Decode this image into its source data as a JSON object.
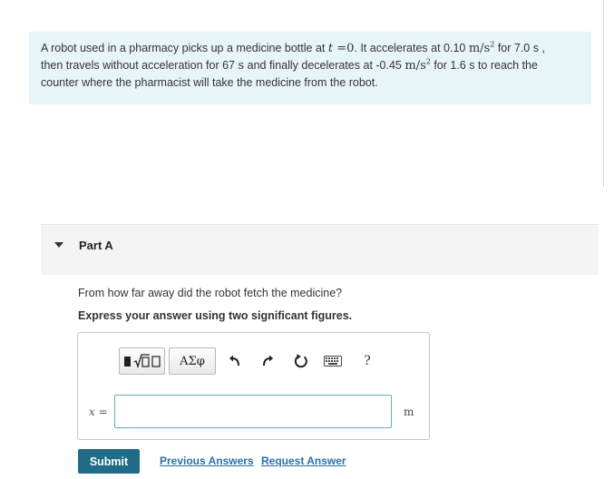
{
  "problem": {
    "part1": "A robot used in a pharmacy picks up a medicine bottle at ",
    "t_var": "t",
    "t_eq": " =0",
    "part2": ". It accelerates at 0.10 ",
    "accel_unit_base": "m/s",
    "accel_unit_exp": "2",
    "part3": " for 7.0 s ,",
    "part4": "then travels without acceleration for 67 ",
    "time_unit": "s",
    "part5": " and finally decelerates at -0.45 ",
    "part6": " for 1.6 s to reach the",
    "part7": "counter where the pharmacist will take the medicine from the robot."
  },
  "part_a": {
    "title": "Part A",
    "question": "From how far away did the robot fetch the medicine?",
    "instruction": "Express your answer using two significant figures."
  },
  "toolbar": {
    "greek_label": "ΑΣφ",
    "help_label": "?"
  },
  "answer": {
    "variable": "x",
    "equals": " =",
    "value": "",
    "unit": "m"
  },
  "actions": {
    "submit_label": "Submit",
    "previous_answers_label": "Previous Answers",
    "request_answer_label": "Request Answer"
  }
}
